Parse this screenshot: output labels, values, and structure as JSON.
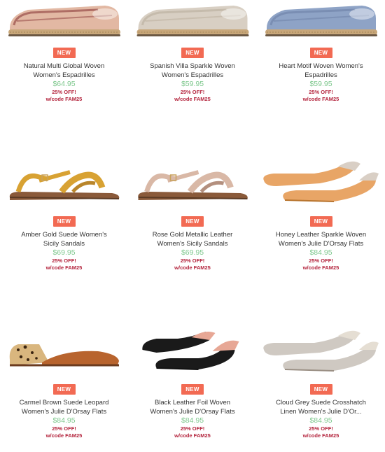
{
  "products": [
    {
      "name": "Natural Multi Global Woven Women's Espadrilles",
      "badge": "NEW",
      "price": "$64.95",
      "promo_line1": "25% OFF!",
      "promo_line2": "w/code FAM25",
      "shoe_type": "espadrille",
      "colors": {
        "main": "#e2b8a3",
        "accent": "#8c3b3b",
        "sole": "#c8a77a"
      }
    },
    {
      "name": "Spanish Villa Sparkle Woven Women's Espadrilles",
      "badge": "NEW",
      "price": "$59.95",
      "promo_line1": "25% OFF!",
      "promo_line2": "w/code FAM25",
      "shoe_type": "espadrille",
      "colors": {
        "main": "#d8cfc3",
        "accent": "#b9ad9c",
        "sole": "#c8a77a"
      }
    },
    {
      "name": "Heart Motif Woven Women's Espadrilles",
      "badge": "NEW",
      "price": "$59.95",
      "promo_line1": "25% OFF!",
      "promo_line2": "w/code FAM25",
      "shoe_type": "espadrille",
      "colors": {
        "main": "#8ea3c6",
        "accent": "#6c80a6",
        "sole": "#c8a77a"
      }
    },
    {
      "name": "Amber Gold Suede Women's Sicily Sandals",
      "badge": "NEW",
      "price": "$69.95",
      "promo_line1": "25% OFF!",
      "promo_line2": "w/code FAM25",
      "shoe_type": "sandal",
      "colors": {
        "main": "#d8a233",
        "accent": "#b9852a",
        "sole": "#8a5a3a"
      }
    },
    {
      "name": "Rose Gold Metallic Leather Women's Sicily Sandals",
      "badge": "NEW",
      "price": "$69.95",
      "promo_line1": "25% OFF!",
      "promo_line2": "w/code FAM25",
      "shoe_type": "sandal",
      "colors": {
        "main": "#d9b8a6",
        "accent": "#b38f7e",
        "sole": "#8a5a3a"
      }
    },
    {
      "name": "Honey Leather Sparkle Woven Women's Julie D'Orsay Flats",
      "badge": "NEW",
      "price": "$84.95",
      "promo_line1": "25% OFF!",
      "promo_line2": "w/code FAM25",
      "shoe_type": "dorsay",
      "colors": {
        "main": "#e8a566",
        "accent": "#d9cfc5",
        "sole": "#b8752f"
      }
    },
    {
      "name": "Carmel Brown Suede Leopard Women's Julie D'Orsay Flats",
      "badge": "NEW",
      "price": "$84.95",
      "promo_line1": "25% OFF!",
      "promo_line2": "w/code FAM25",
      "shoe_type": "dorsay-leopard",
      "colors": {
        "main": "#b8642e",
        "accent": "#d9b67e",
        "sole": "#6b3b1f"
      }
    },
    {
      "name": "Black Leather Foil Woven Women's Julie D'Orsay Flats",
      "badge": "NEW",
      "price": "$84.95",
      "promo_line1": "25% OFF!",
      "promo_line2": "w/code FAM25",
      "shoe_type": "dorsay-pair",
      "colors": {
        "main": "#1a1a1a",
        "accent": "#e7a795",
        "sole": "#111111"
      }
    },
    {
      "name": "Cloud Grey Suede Crosshatch Linen Women's Julie D'Or...",
      "badge": "NEW",
      "price": "$84.95",
      "promo_line1": "25% OFF!",
      "promo_line2": "w/code FAM25",
      "shoe_type": "dorsay",
      "colors": {
        "main": "#cfc9c2",
        "accent": "#e5ded3",
        "sole": "#9a8f84"
      }
    }
  ]
}
